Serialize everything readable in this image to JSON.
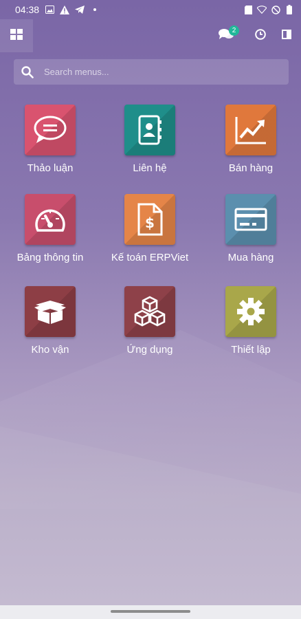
{
  "status": {
    "time": "04:38"
  },
  "topbar": {
    "chat_badge": "2"
  },
  "search": {
    "placeholder": "Search menus..."
  },
  "apps": [
    {
      "label": "Thảo luận",
      "color": "#d9536f",
      "icon": "chat-bubble-icon"
    },
    {
      "label": "Liên hệ",
      "color": "#1f8e8a",
      "icon": "address-book-icon"
    },
    {
      "label": "Bán hàng",
      "color": "#e0783c",
      "icon": "trending-chart-icon"
    },
    {
      "label": "Bảng thông tin",
      "color": "#c84e6c",
      "icon": "dashboard-gauge-icon"
    },
    {
      "label": "Kế toán ERPViet",
      "color": "#e58548",
      "icon": "dollar-document-icon"
    },
    {
      "label": "Mua hàng",
      "color": "#5b8fae",
      "icon": "credit-card-icon"
    },
    {
      "label": "Kho vận",
      "color": "#8d3e45",
      "icon": "open-box-icon"
    },
    {
      "label": "Ứng dụng",
      "color": "#8e4149",
      "icon": "cubes-icon"
    },
    {
      "label": "Thiết lập",
      "color": "#a9a74a",
      "icon": "gear-icon"
    }
  ]
}
